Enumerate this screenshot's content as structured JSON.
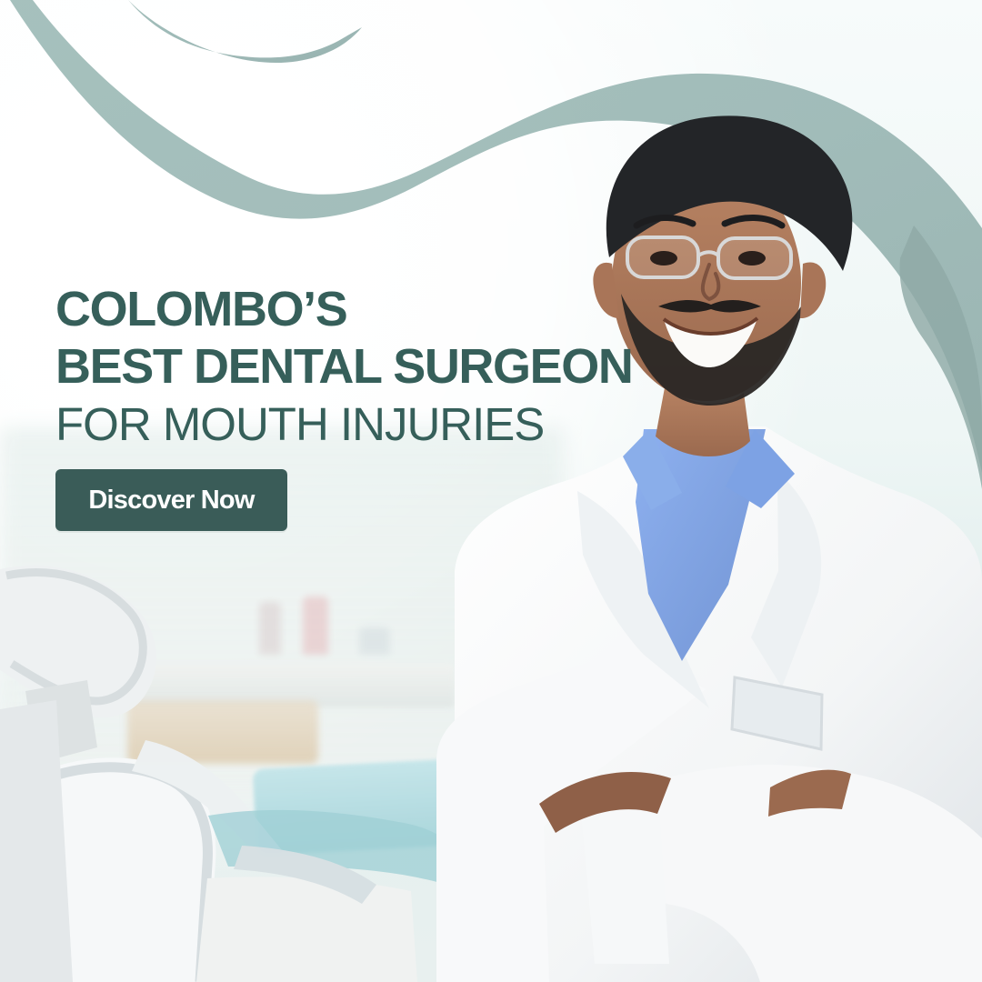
{
  "brand_colors": {
    "accent": "#3a5c58",
    "headline": "#365f5a",
    "arc": "#8fb0ad",
    "coat": "#f6f8f8",
    "shirt": "#7fa6e8"
  },
  "headline": {
    "line1": "COLOMBO’S",
    "line2": "BEST DENTAL SURGEON",
    "line3": "FOR MOUTH INJURIES"
  },
  "cta": {
    "label": "Discover Now"
  },
  "visuals": {
    "background": "dental-clinic-room",
    "foreground_person": "smiling-dental-surgeon-with-glasses-and-white-coat"
  }
}
